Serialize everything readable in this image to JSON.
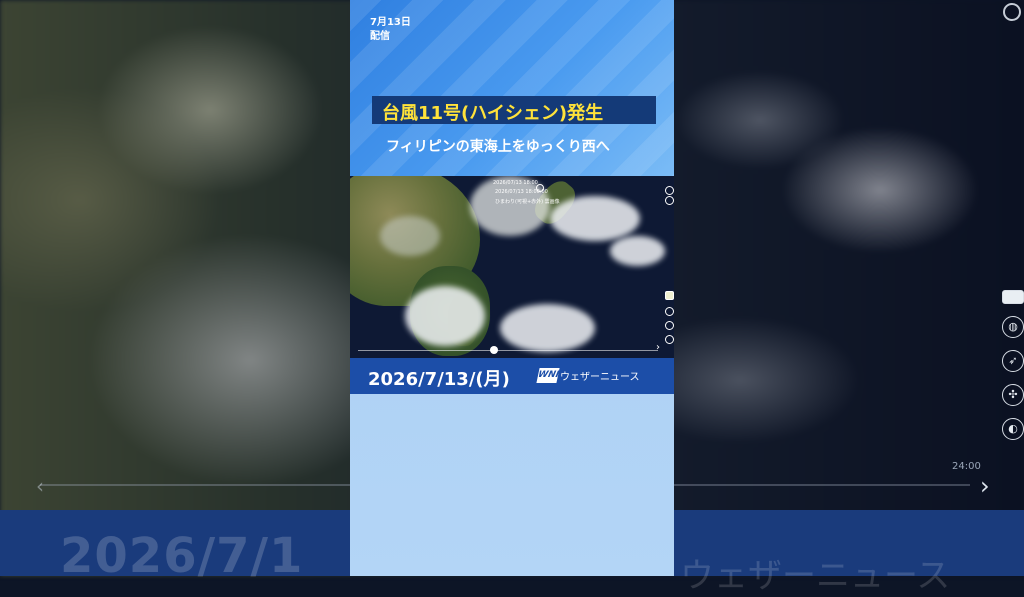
{
  "background": {
    "date_ghost": "2026/7/1",
    "brand_ghost": "ウェザーニュース",
    "time_label": "24:00",
    "chevron_left": "‹",
    "chevron_right": "›"
  },
  "card": {
    "delivery_lines": [
      "7月13日",
      "配信"
    ],
    "headline": "台風11号(ハイシェン)発生",
    "subheadline": "フィリピンの東海上をゆっくり西へ",
    "date": "2026/7/13/(月)",
    "logo": "WNI",
    "brand": "ウェザーニュース",
    "colors": {
      "headline_text": "#ffe23a",
      "headline_bg": "#143a78",
      "date_band": "#1c4ea8"
    }
  },
  "map": {
    "labels": [
      "2026/07/13 18:00",
      "2026/07/13 18:00:00",
      "ひまわり(可視+赤外) 雲画像"
    ],
    "chevron": "›"
  }
}
